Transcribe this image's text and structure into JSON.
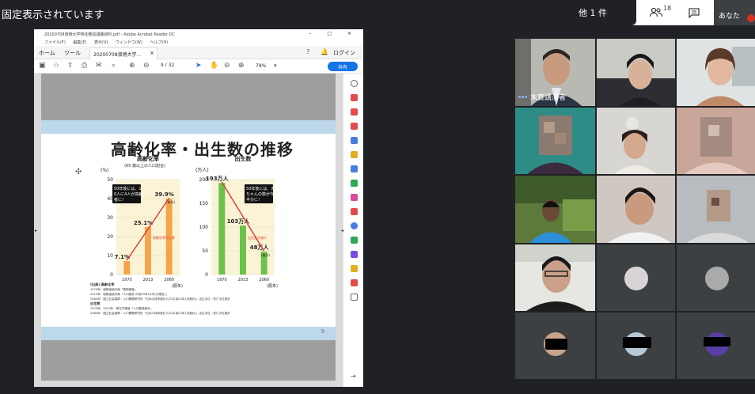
{
  "banner": {
    "pin_text": "固定表示されています"
  },
  "meet_top": {
    "others_label": "他 1 件",
    "participant_count": "18",
    "self_label": "あなた"
  },
  "pdf": {
    "title": "20200708淑徳大学特任教授講義資料.pdf - Adobe Acrobat Reader DC",
    "menu": "ファイル(F) 編集(E) 表示(V) ウィンドウ(W) ヘルプ(H)",
    "tab_home": "ホーム",
    "tab_tools": "ツール",
    "tab_doc": "20200708淑徳大学...",
    "login": "ログイン",
    "page_input": "9",
    "page_total": "/ 32",
    "zoom": "78%",
    "share": "共有",
    "win_controls": "– □ ✕",
    "help_icon": "?",
    "bell_icon": "🔔"
  },
  "slide": {
    "title": "高齢化率・出生数の推移",
    "page_number": "9"
  },
  "chart_data": [
    {
      "type": "bar",
      "title": "高齢化率",
      "subtitle": "(65 歳以上の人口割合)",
      "ylabel": "(%)",
      "xlabel": "(暦年)",
      "categories": [
        "1970",
        "2013",
        "2060"
      ],
      "values": [
        7.1,
        25.1,
        39.9
      ],
      "value_labels": [
        "7.1%",
        "25.1%",
        "39.9%"
      ],
      "value_note": "(推計)",
      "ylim": [
        0,
        50
      ],
      "yticks": [
        "0",
        "10",
        "20",
        "30",
        "40",
        "50"
      ],
      "bar_color": "#f6a44c",
      "callout": "50年後には、10人に4人が高齢者に！",
      "trend_label": "高齢化率が上昇"
    },
    {
      "type": "bar",
      "title": "出生数",
      "ylabel": "(万人)",
      "xlabel": "(暦年)",
      "categories": [
        "1970",
        "2013",
        "2060"
      ],
      "values": [
        193,
        103,
        48
      ],
      "value_labels": [
        "193万人",
        "103万人",
        "48万人"
      ],
      "value_note": "(推計)",
      "ylim": [
        0,
        200
      ],
      "yticks": [
        "0",
        "50",
        "100",
        "150",
        "200"
      ],
      "bar_color": "#6cc24a",
      "callout": "50年後には、赤ちゃんの数が今の半分に！",
      "trend_label": "出生数が減少"
    }
  ],
  "sources": {
    "lines": [
      "(出典) 高齢化率",
      "1970年：総務省統計局「国勢調査」",
      "2013年：総務省統計局「人口推計(平成25年10月1日現在)」",
      "2060年：国立社会保障・人口問題研究所「日本の将来推計人口(平成24年1月推計)」出生中位・死亡中位推計",
      "出生数",
      "1970年、2013年：厚生労働省「人口動態統計」",
      "2060年：国立社会保障・人口問題研究所「日本の将来推計人口(平成24年1月推計)」出生中位・死亡中位推計"
    ]
  },
  "participants": {
    "speaker_name": "末寶講演者"
  }
}
